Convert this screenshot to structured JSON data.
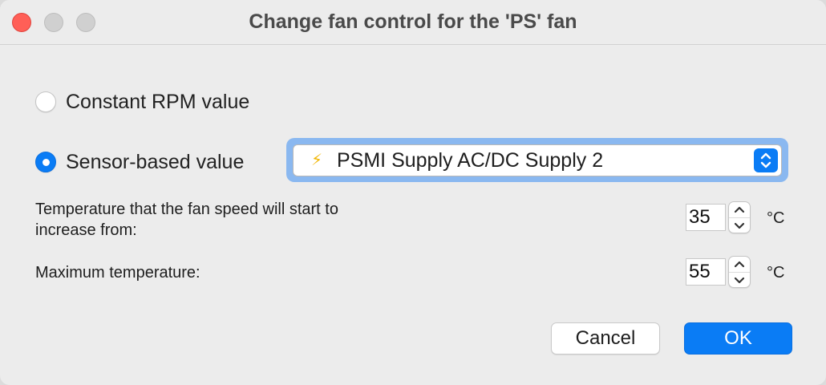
{
  "window": {
    "title": "Change fan control for the 'PS' fan"
  },
  "options": {
    "constant_rpm": {
      "label": "Constant RPM value",
      "selected": false
    },
    "sensor_based": {
      "label": "Sensor-based value",
      "selected": true
    }
  },
  "sensor_select": {
    "icon": "lightning-bolt-icon",
    "value": "PSMI Supply AC/DC Supply 2"
  },
  "start_temperature": {
    "label_line1": "Temperature that the fan speed will start to",
    "label_line2": "increase from:",
    "value": "35",
    "unit": "°C"
  },
  "max_temperature": {
    "label": "Maximum temperature:",
    "value": "55",
    "unit": "°C"
  },
  "buttons": {
    "cancel": "Cancel",
    "ok": "OK"
  },
  "colors": {
    "accent": "#0a7cf5",
    "close": "#ff5f57",
    "focus_ring": "#8ab8f0",
    "window_bg": "#ececec"
  }
}
